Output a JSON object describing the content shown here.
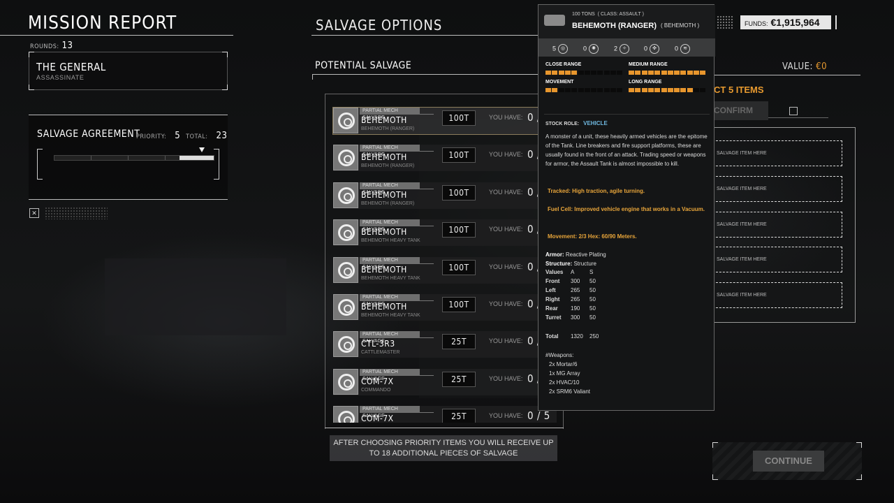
{
  "mission": {
    "title": "MISSION REPORT",
    "rounds_label": "ROUNDS:",
    "rounds": "13",
    "contract_name": "THE GENERAL",
    "contract_type": "ASSASSINATE"
  },
  "salvage_agreement": {
    "title": "SALVAGE AGREEMENT",
    "priority_label": "PRIORITY:",
    "priority": "5",
    "total_label": "TOTAL:",
    "total": "23",
    "priority_fraction": 0.217
  },
  "salvage": {
    "title": "SALVAGE OPTIONS",
    "potential": "POTENTIAL SALVAGE",
    "items": [
      {
        "tag": "PARTIAL MECH SALVAGE",
        "name": "BEHEMOTH",
        "sub": "BEHEMOTH (RANGER)",
        "tons": "100T",
        "have_label": "YOU HAVE:",
        "count": "0 /"
      },
      {
        "tag": "PARTIAL MECH SALVAGE",
        "name": "BEHEMOTH",
        "sub": "BEHEMOTH (RANGER)",
        "tons": "100T",
        "have_label": "YOU HAVE:",
        "count": "0 /"
      },
      {
        "tag": "PARTIAL MECH SALVAGE",
        "name": "BEHEMOTH",
        "sub": "BEHEMOTH (RANGER)",
        "tons": "100T",
        "have_label": "YOU HAVE:",
        "count": "0 /"
      },
      {
        "tag": "PARTIAL MECH SALVAGE",
        "name": "BEHEMOTH",
        "sub": "BEHEMOTH HEAVY TANK",
        "tons": "100T",
        "have_label": "YOU HAVE:",
        "count": "0 /"
      },
      {
        "tag": "PARTIAL MECH SALVAGE",
        "name": "BEHEMOTH",
        "sub": "BEHEMOTH HEAVY TANK",
        "tons": "100T",
        "have_label": "YOU HAVE:",
        "count": "0 /"
      },
      {
        "tag": "PARTIAL MECH SALVAGE",
        "name": "BEHEMOTH",
        "sub": "BEHEMOTH HEAVY TANK",
        "tons": "100T",
        "have_label": "YOU HAVE:",
        "count": "0 /"
      },
      {
        "tag": "PARTIAL MECH SALVAGE",
        "name": "CTL-3R3",
        "sub": "CATTLEMASTER",
        "tons": "25T",
        "have_label": "YOU HAVE:",
        "count": "0 /"
      },
      {
        "tag": "PARTIAL MECH SALVAGE",
        "name": "COM-7X",
        "sub": "COMMANDO",
        "tons": "25T",
        "have_label": "YOU HAVE:",
        "count": "0 /"
      },
      {
        "tag": "PARTIAL MECH SALVAGE",
        "name": "COM-7X",
        "sub": "",
        "tons": "25T",
        "have_label": "YOU HAVE:",
        "count": "0 / 5"
      }
    ],
    "info": "AFTER CHOOSING PRIORITY ITEMS YOU WILL RECEIVE UP TO 18 ADDITIONAL PIECES OF SALVAGE"
  },
  "funds": {
    "label": "FUNDS:",
    "value": "€1,915,964"
  },
  "right": {
    "value_label": "VALUE:",
    "value": "€0",
    "select": "CT 5 ITEMS",
    "confirm": "CONFIRM",
    "slot_label": "SALVAGE ITEM HERE",
    "continue": "CONTINUE"
  },
  "tooltip": {
    "tons": "100 TONS",
    "class": "( CLASS: ASSAULT )",
    "name": "BEHEMOTH (RANGER)",
    "variant": "( BEHEMOTH )",
    "stats": [
      "5",
      "0",
      "2",
      "0",
      "0"
    ],
    "ranges": [
      {
        "label": "CLOSE RANGE",
        "level": 0.42
      },
      {
        "label": "MEDIUM RANGE",
        "level": 1.0
      },
      {
        "label": "MOVEMENT",
        "level": 0.2
      },
      {
        "label": "LONG RANGE",
        "level": 0.86
      }
    ],
    "role_label": "STOCK ROLE:",
    "role": "VEHICLE",
    "description": "A monster of a unit, these heavily armed vehicles are the epitome of the Tank.  Line breakers and fire support platforms, these are usually found in the front of an attack. Trading speed or weapons for armor, the Assault Tank is almost impossible to kill.",
    "tracked": "Tracked: High traction, agile turning.",
    "fuel": "Fuel Cell: Improved vehicle engine that works in a Vacuum.",
    "movement": "Movement: 2/3 Hex: 60/90 Meters.",
    "armor_label": "Armor:",
    "armor": "Reactive Plating",
    "structure_label": "Structure:",
    "structure": "Structure",
    "values_header": [
      "Values",
      "A",
      "S"
    ],
    "values": [
      [
        "Front",
        "300",
        "50"
      ],
      [
        "Left",
        "265",
        "50"
      ],
      [
        "Right",
        "265",
        "50"
      ],
      [
        "Rear",
        "190",
        "50"
      ],
      [
        "Turret",
        "300",
        "50"
      ]
    ],
    "total": [
      "Total",
      "1320",
      "250"
    ],
    "weapons_label": "#Weapons:",
    "weapons": [
      "2x Mortar/6",
      "1x MG Array",
      "2x HVAC/10",
      "2x SRM6 Valiant"
    ]
  }
}
